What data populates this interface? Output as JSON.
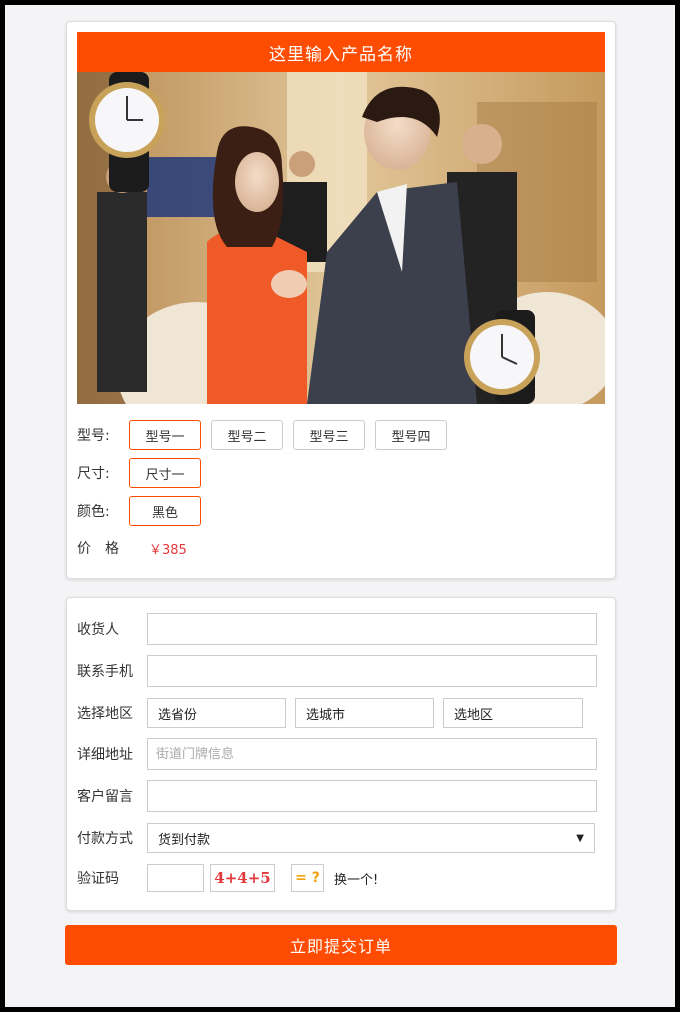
{
  "product": {
    "title": "这里输入产品名称",
    "image_alt": "product-photo"
  },
  "options": {
    "model": {
      "label": "型号:",
      "values": [
        "型号一",
        "型号二",
        "型号三",
        "型号四"
      ],
      "selected": "型号一"
    },
    "size": {
      "label": "尺寸:",
      "values": [
        "尺寸一"
      ],
      "selected": "尺寸一"
    },
    "color": {
      "label": "颜色:",
      "values": [
        "黑色"
      ],
      "selected": "黑色"
    }
  },
  "price": {
    "label": "价　格",
    "value": "￥385"
  },
  "form": {
    "recipient_label": "收货人",
    "phone_label": "联系手机",
    "region_label": "选择地区",
    "province": "选省份",
    "city": "选城市",
    "district": "选地区",
    "address_label": "详细地址",
    "address_placeholder": "街道门牌信息",
    "message_label": "客户留言",
    "payment_label": "付款方式",
    "payment_value": "货到付款",
    "captcha_label": "验证码",
    "captcha_expr": "4+4+5",
    "captcha_q": "= ?",
    "refresh_label": "换一个!"
  },
  "submit_label": "立即提交订单",
  "colors": {
    "accent": "#fe4c02",
    "price": "#e4393c"
  }
}
